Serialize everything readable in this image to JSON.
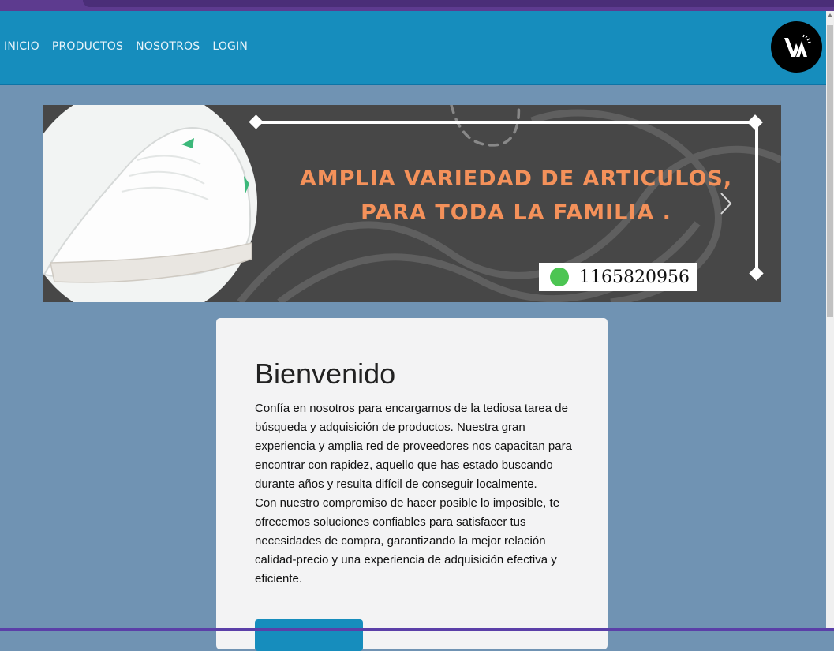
{
  "nav": {
    "items": [
      {
        "label": "INICIO"
      },
      {
        "label": "PRODUCTOS"
      },
      {
        "label": "NOSOTROS"
      },
      {
        "label": "LOGIN"
      }
    ],
    "logo_text": "VA",
    "logo_icon": "brand-logo-icon"
  },
  "carousel": {
    "headline_line1": "AMPLIA VARIEDAD DE ARTICULOS,",
    "headline_line2": "PARA TODA LA FAMILIA .",
    "phone_icon": "whatsapp-icon",
    "phone_number": "1165820956",
    "next_icon": "chevron-right-icon"
  },
  "welcome": {
    "title": "Bienvenido",
    "paragraph1": "Confía en nosotros para encargarnos de la tediosa tarea de búsqueda y adquisición de productos. Nuestra gran experiencia y amplia red de proveedores nos capacitan para encontrar con rapidez, aquello que has estado buscando durante años y resulta difícil de conseguir localmente.",
    "paragraph2": "Con nuestro compromiso de hacer posible lo imposible, te ofrecemos soluciones confiables para satisfacer tus necesidades de compra, garantizando la mejor relación calidad-precio y una experiencia de adquisición efectiva y eficiente.",
    "button_label": ""
  },
  "colors": {
    "page_background": "#7093b3",
    "navbar": "#168dbd",
    "banner_background": "#474747",
    "headline": "#f4915a",
    "card": "#f3f3f4"
  }
}
